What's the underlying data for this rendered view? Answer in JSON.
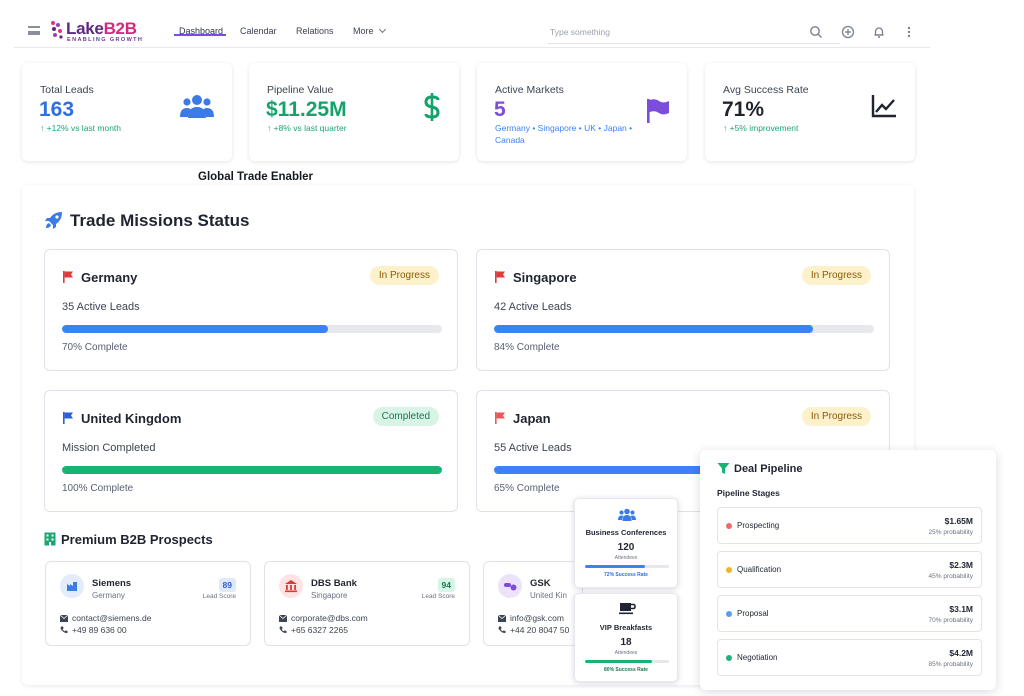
{
  "brand": {
    "name_main": "Lake",
    "name_accent": "B2B",
    "tagline": "ENABLING GROWTH"
  },
  "nav": {
    "items": [
      "Dashboard",
      "Calendar",
      "Relations",
      "More"
    ],
    "active": "Dashboard"
  },
  "search": {
    "placeholder": "Type something"
  },
  "stats": [
    {
      "label": "Total Leads",
      "value": "163",
      "sub": "↑ +12% vs last month",
      "color": "#2d6fe0",
      "icon": "people-icon"
    },
    {
      "label": "Pipeline Value",
      "value": "$11.25M",
      "sub": "↑ +8% vs last quarter",
      "color": "#15a36b",
      "icon": "dollar-icon"
    },
    {
      "label": "Active Markets",
      "value": "5",
      "sub": "Germany • Singapore • UK • Japan • Canada",
      "color": "#7c4ddb",
      "icon": "flag-icon"
    },
    {
      "label": "Avg Success Rate",
      "value": "71%",
      "sub": "↑ +5% improvement",
      "color": "#1f2430",
      "icon": "chart-line-icon"
    }
  ],
  "brand_line": "Global Trade Enabler",
  "missions": {
    "title": "Trade Missions Status",
    "items": [
      {
        "country": "Germany",
        "status": "In Progress",
        "leads": "35 Active Leads",
        "progress": 0.7,
        "pct_label": "70% Complete",
        "flag_color": "#e03a3a",
        "bar_color": "#3b82f6"
      },
      {
        "country": "Singapore",
        "status": "In Progress",
        "leads": "42 Active Leads",
        "progress": 0.84,
        "pct_label": "84% Complete",
        "flag_color": "#e03a3a",
        "bar_color": "#3b82f6"
      },
      {
        "country": "United Kingdom",
        "status": "Completed",
        "leads": "Mission Completed",
        "progress": 1.0,
        "pct_label": "100% Complete",
        "flag_color": "#2d5fd6",
        "bar_color": "#16b373"
      },
      {
        "country": "Japan",
        "status": "In Progress",
        "leads": "55 Active Leads",
        "progress": 0.65,
        "pct_label": "65% Complete",
        "flag_color": "#e85a5a",
        "bar_color": "#3b82f6"
      }
    ]
  },
  "prospects": {
    "title": "Premium B2B Prospects",
    "items": [
      {
        "name": "Siemens",
        "country": "Germany",
        "score": "89",
        "score_label": "Lead Score",
        "email": "contact@siemens.de",
        "phone": "+49 89 636 00"
      },
      {
        "name": "DBS Bank",
        "country": "Singapore",
        "score": "94",
        "score_label": "Lead Score",
        "email": "corporate@dbs.com",
        "phone": "+65 6327 2265"
      },
      {
        "name": "GSK",
        "country": "United Kin",
        "score": "",
        "score_label": "",
        "email": "info@gsk.com",
        "phone": "+44 20 8047 50"
      }
    ]
  },
  "events": [
    {
      "title": "Business Conferences",
      "count": "120",
      "count_label": "Attendees",
      "rate": 0.72,
      "rate_label": "72% Success Rate",
      "color": "#3b82f6"
    },
    {
      "title": "VIP Breakfasts",
      "count": "18",
      "count_label": "Attendees",
      "rate": 0.8,
      "rate_label": "80% Success Rate",
      "color": "#16b373"
    }
  ],
  "pipeline": {
    "title": "Deal Pipeline",
    "subtitle": "Pipeline Stages",
    "stages": [
      {
        "name": "Prospecting",
        "amount": "$1.65M",
        "prob": "25% probability",
        "color": "#ef6b6b"
      },
      {
        "name": "Qualification",
        "amount": "$2.3M",
        "prob": "45% probability",
        "color": "#f0b429"
      },
      {
        "name": "Proposal",
        "amount": "$3.1M",
        "prob": "70% probability",
        "color": "#5b9cf0"
      },
      {
        "name": "Negotiation",
        "amount": "$4.2M",
        "prob": "85% probability",
        "color": "#22b07a"
      }
    ]
  }
}
